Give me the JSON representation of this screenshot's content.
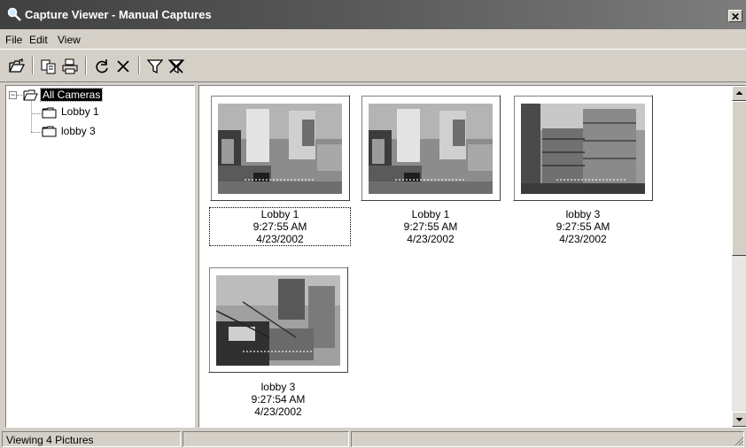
{
  "window": {
    "title": "Capture Viewer - Manual Captures",
    "close_glyph": "✕"
  },
  "menu": [
    {
      "label": "File"
    },
    {
      "label": "Edit"
    },
    {
      "label": "View"
    }
  ],
  "toolbar": {
    "buttons": [
      {
        "icon": "open-folder-icon"
      },
      {
        "icon": "copy-icon"
      },
      {
        "icon": "print-icon"
      },
      {
        "icon": "refresh-icon"
      },
      {
        "icon": "delete-icon"
      },
      {
        "icon": "filter-icon"
      },
      {
        "icon": "clear-filter-icon"
      }
    ]
  },
  "tree": {
    "root": {
      "label": "All Cameras",
      "expander": "−"
    },
    "children": [
      {
        "label": "Lobby 1"
      },
      {
        "label": "lobby 3"
      }
    ]
  },
  "thumbnails": [
    {
      "camera": "Lobby 1",
      "time": "9:27:55 AM",
      "date": "4/23/2002",
      "scene": "lobby-office"
    },
    {
      "camera": "Lobby 1",
      "time": "9:27:55 AM",
      "date": "4/23/2002",
      "scene": "lobby-office"
    },
    {
      "camera": "lobby 3",
      "time": "9:27:55 AM",
      "date": "4/23/2002",
      "scene": "paper-stacks"
    },
    {
      "camera": "lobby 3",
      "time": "9:27:54 AM",
      "date": "4/23/2002",
      "scene": "workbench"
    }
  ],
  "status": {
    "text": "Viewing 4 Pictures",
    "cell2": "",
    "cell3": ""
  },
  "colors": {
    "titlebar_start": "#404040",
    "titlebar_end": "#7d7d7d",
    "face": "#d4d0c8",
    "selection": "#000000"
  }
}
